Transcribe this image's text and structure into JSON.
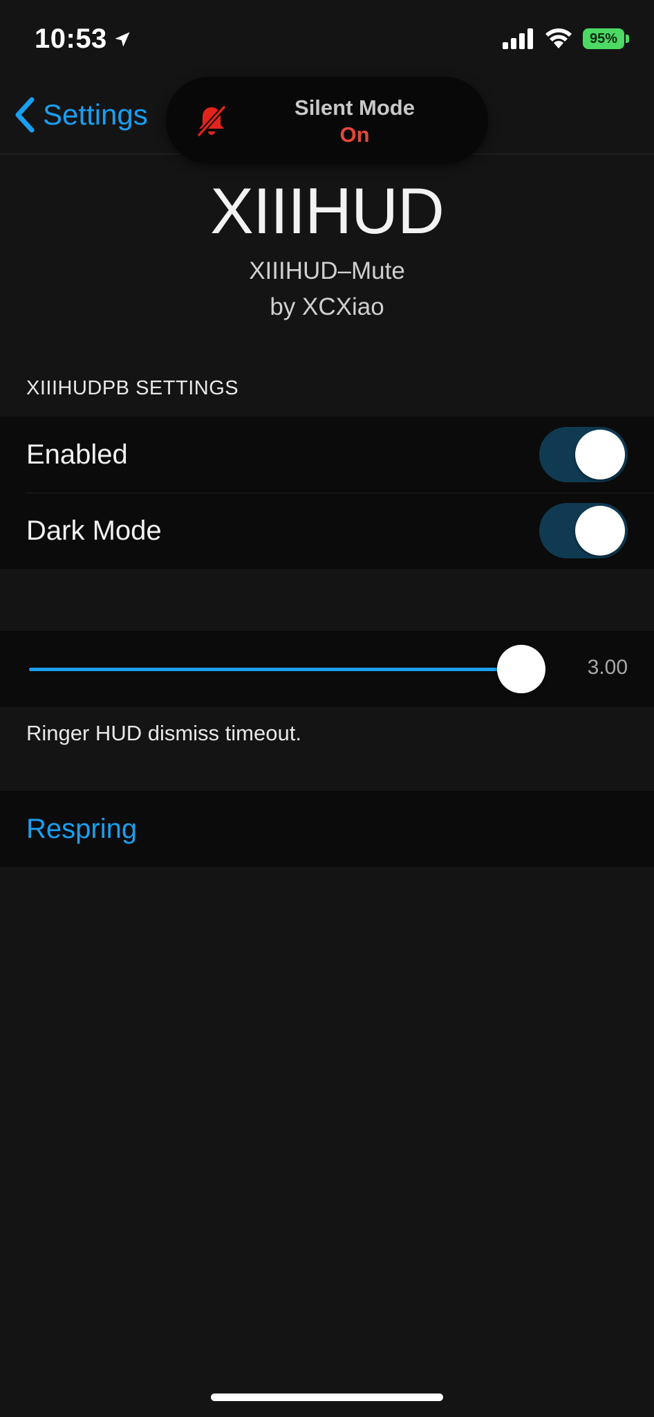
{
  "status_bar": {
    "time": "10:53",
    "battery": "95%",
    "location_icon": "location-arrow-icon",
    "signal_icon": "cellular-signal-icon",
    "wifi_icon": "wifi-icon",
    "battery_color": "#4cd964"
  },
  "nav": {
    "back_label": "Settings",
    "back_icon": "chevron-left-icon",
    "accent": "#1a9ff0"
  },
  "hud": {
    "title": "Silent Mode",
    "state": "On",
    "icon": "bell-slash-icon",
    "state_color": "#e5473a"
  },
  "header": {
    "app_name": "XIIIHUD",
    "subtitle": "XIIIHUD–Mute",
    "author": "by XCXiao"
  },
  "settings": {
    "section_title": "XIIIHUDPB SETTINGS",
    "rows": [
      {
        "label": "Enabled",
        "on": true
      },
      {
        "label": "Dark Mode",
        "on": true
      }
    ]
  },
  "timeout": {
    "value": 3.0,
    "value_label": "3.00",
    "fraction": 0.96,
    "footer": "Ringer HUD dismiss timeout."
  },
  "actions": {
    "respring_label": "Respring"
  }
}
